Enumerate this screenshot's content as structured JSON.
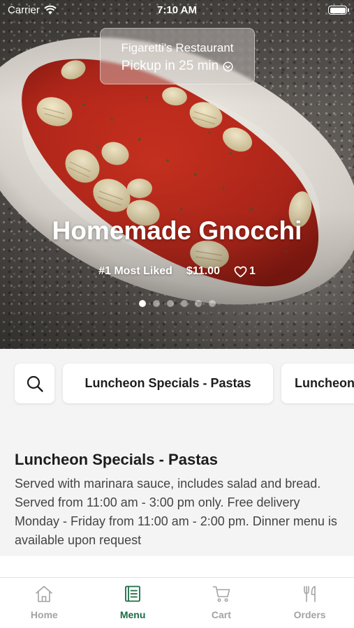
{
  "status_bar": {
    "carrier": "Carrier",
    "time": "7:10 AM"
  },
  "restaurant": {
    "name": "Figaretti's Restaurant",
    "pickup": "Pickup in 25 min"
  },
  "featured": {
    "title": "Homemade Gnocchi",
    "rank": "#1 Most Liked",
    "price": "$11.00",
    "likes": "1",
    "carousel_count": 6,
    "carousel_active": 1
  },
  "categories": [
    "Luncheon Specials - Pastas",
    "Luncheon"
  ],
  "section": {
    "title": "Luncheon Specials - Pastas",
    "description": "Served with marinara sauce, includes salad and bread. Served from 11:00 am - 3:00 pm only. Free delivery Monday - Friday from 11:00 am - 2:00 pm. Dinner menu is available upon request"
  },
  "tabs": [
    {
      "label": "Home",
      "icon": "home-icon",
      "active": false
    },
    {
      "label": "Menu",
      "icon": "menu-icon",
      "active": true
    },
    {
      "label": "Cart",
      "icon": "cart-icon",
      "active": false
    },
    {
      "label": "Orders",
      "icon": "orders-icon",
      "active": false
    }
  ],
  "colors": {
    "accent": "#1a6b46",
    "inactive": "#a3a3a3",
    "sauce": "#b8281c"
  }
}
